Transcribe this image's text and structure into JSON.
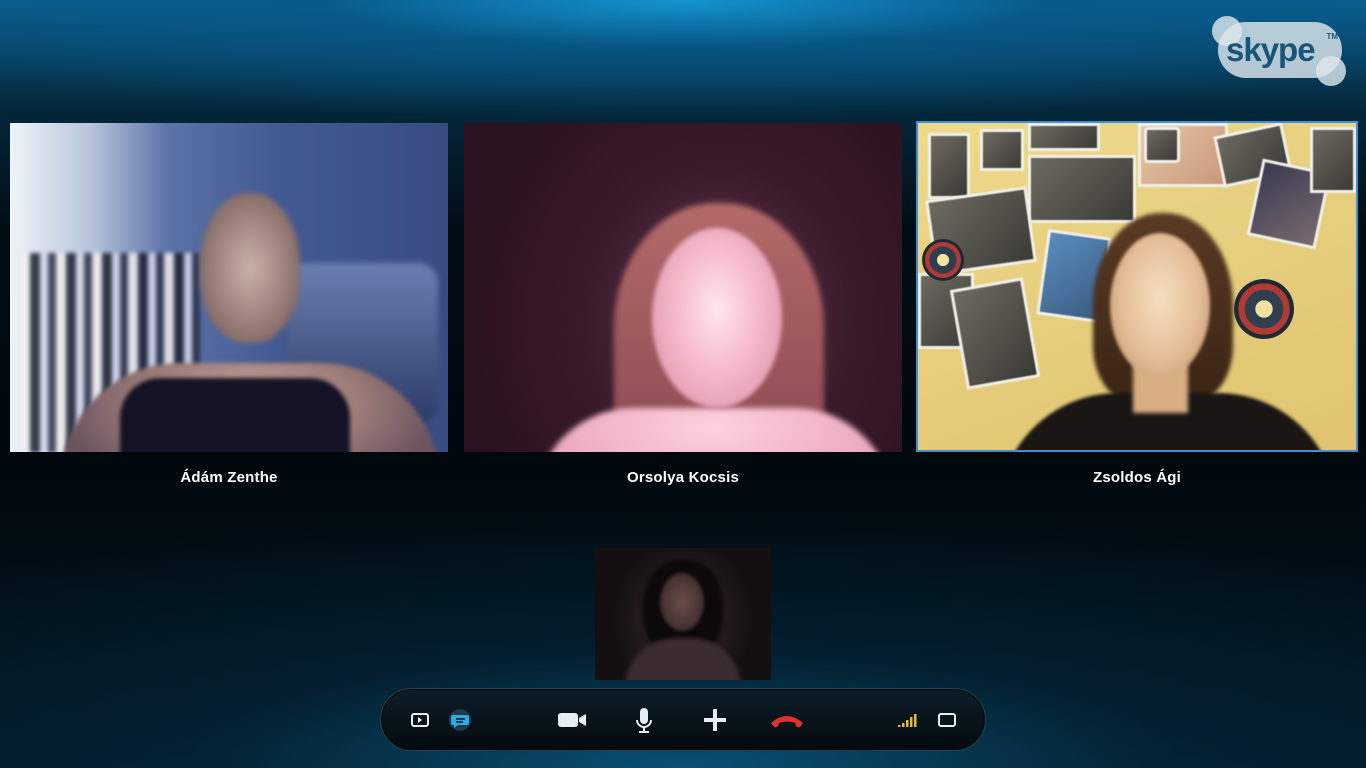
{
  "app": {
    "logo_text": "skype",
    "logo_mark": "TM"
  },
  "participants": [
    {
      "name": "Ádám Zenthe"
    },
    {
      "name": "Orsolya Kocsis"
    },
    {
      "name": "Zsoldos Ági"
    }
  ],
  "active_speaker_index": 2,
  "colors": {
    "active_border": "#3f8fd6",
    "hangup": "#e0302a",
    "chat_accent": "#2fa9e6",
    "signal": "#e8b83a"
  },
  "toolbar": {
    "buttons": [
      {
        "icon": "show-contacts-icon"
      },
      {
        "icon": "chat-bubble-icon"
      },
      {
        "icon": "video-camera-icon"
      },
      {
        "icon": "microphone-icon"
      },
      {
        "icon": "plus-icon"
      },
      {
        "icon": "hang-up-phone-icon"
      },
      {
        "icon": "signal-strength-icon"
      },
      {
        "icon": "fullscreen-icon"
      }
    ]
  }
}
